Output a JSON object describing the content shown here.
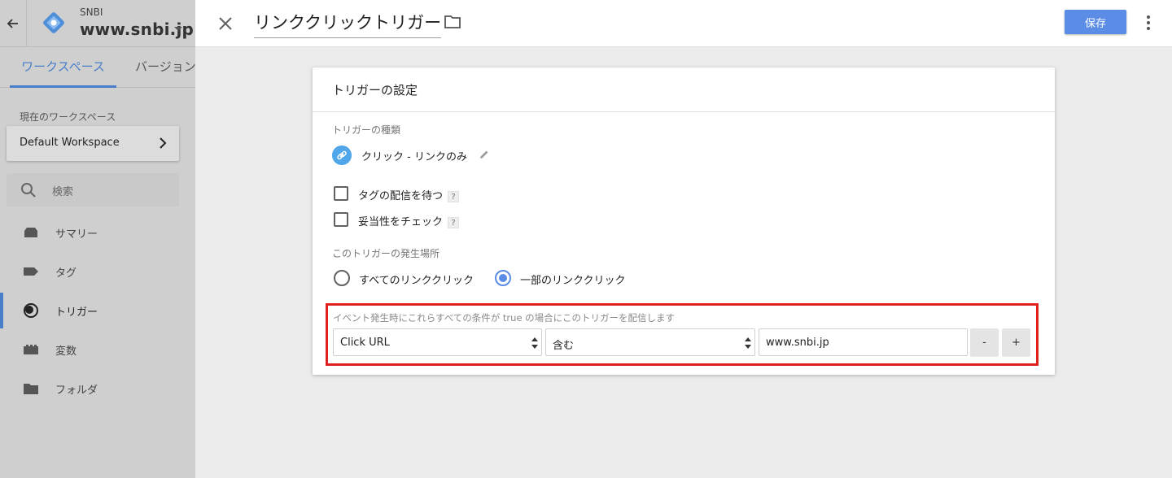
{
  "sidebar": {
    "account_label": "SNBI",
    "container_name": "www.snbi.jp",
    "tabs": [
      {
        "label": "ワークスペース"
      },
      {
        "label": "バージョン"
      }
    ],
    "workspace_caption": "現在のワークスペース",
    "workspace_name": "Default Workspace",
    "search_placeholder": "検索",
    "nav": [
      {
        "label": "サマリー",
        "icon": "summary-icon"
      },
      {
        "label": "タグ",
        "icon": "tag-icon"
      },
      {
        "label": "トリガー",
        "icon": "trigger-icon",
        "active": true
      },
      {
        "label": "変数",
        "icon": "variable-icon"
      },
      {
        "label": "フォルダ",
        "icon": "folder-icon"
      }
    ]
  },
  "header": {
    "title": "リンククリックトリガー",
    "save_label": "保存"
  },
  "card": {
    "title": "トリガーの設定",
    "type_caption": "トリガーの種類",
    "type_name": "クリック - リンクのみ",
    "checkboxes": [
      {
        "label": "タグの配信を待つ",
        "help": "?",
        "checked": false
      },
      {
        "label": "妥当性をチェック",
        "help": "?",
        "checked": false
      }
    ],
    "where_caption": "このトリガーの発生場所",
    "radios": [
      {
        "label": "すべてのリンククリック",
        "checked": false
      },
      {
        "label": "一部のリンククリック",
        "checked": true
      }
    ],
    "filter": {
      "caption": "イベント発生時にこれらすべての条件が true の場合にこのトリガーを配信します",
      "variable": "Click URL",
      "operator": "含む",
      "value": "www.snbi.jp",
      "minus_label": "-",
      "plus_label": "+"
    }
  },
  "colors": {
    "accent": "#4a7ec9",
    "save_button": "#5b8de6",
    "highlight_border": "#e0201c",
    "trigger_type_icon": "#4fa6e8"
  }
}
